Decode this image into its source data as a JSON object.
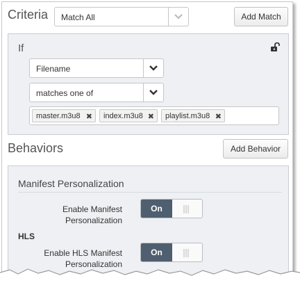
{
  "criteria": {
    "title": "Criteria",
    "match_select": "Match All",
    "add_match_label": "Add Match"
  },
  "if_block": {
    "label": "If",
    "field_select": "Filename",
    "operator_select": "matches one of",
    "values": [
      "master.m3u8",
      "index.m3u8",
      "playlist.m3u8"
    ],
    "remove_glyph": "✖"
  },
  "behaviors": {
    "title": "Behaviors",
    "add_behavior_label": "Add Behavior"
  },
  "manifest_personalization": {
    "title": "Manifest Personalization",
    "enable_label_line1": "Enable Manifest",
    "enable_label_line2": "Personalization",
    "enable_state": "On",
    "hls_heading": "HLS",
    "hls_label_line1": "Enable HLS Manifest",
    "hls_label_line2": "Personalization",
    "hls_state": "On"
  },
  "colors": {
    "toggle_on": "#4f5f70",
    "panel_bg": "#eef0f3"
  }
}
